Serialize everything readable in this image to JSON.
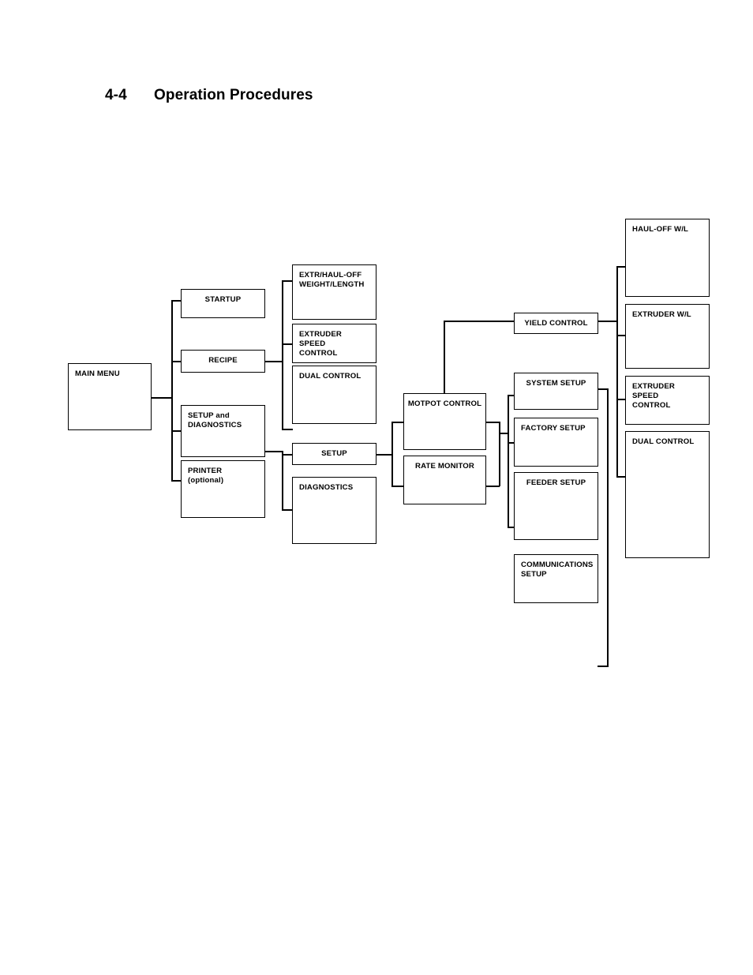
{
  "page": {
    "section_number": "4-4",
    "section_title": "Operation Procedures"
  },
  "diagram": {
    "type": "menu-tree",
    "root": "MAIN MENU",
    "nodes": {
      "main_menu": "MAIN MENU",
      "startup": "STARTUP",
      "recipe": "RECIPE",
      "setup_and_diagnostics": "SETUP and\nDIAGNOSTICS",
      "printer_optional": "PRINTER (optional)",
      "extr_haul_off_weight_length": "EXTR/HAUL-OFF\nWEIGHT/LENGTH",
      "extruder_speed_control_col2": "EXTRUDER SPEED\nCONTROL",
      "dual_control_col2": "DUAL CONTROL",
      "setup": "SETUP",
      "diagnostics": "DIAGNOSTICS",
      "motpot_control": "MOTPOT CONTROL",
      "rate_monitor": "RATE MONITOR",
      "yield_control": "YIELD CONTROL",
      "system_setup": "SYSTEM SETUP",
      "factory_setup": "FACTORY SETUP",
      "feeder_setup": "FEEDER SETUP",
      "communications_setup": "COMMUNICATIONS\nSETUP",
      "haul_off_wl": "HAUL-OFF W/L",
      "extruder_wl": "EXTRUDER W/L",
      "extruder_speed_control_col5": "EXTRUDER SPEED\nCONTROL",
      "dual_control_col5": "DUAL CONTROL"
    },
    "edges": [
      {
        "from": "main_menu",
        "to": "startup"
      },
      {
        "from": "main_menu",
        "to": "recipe"
      },
      {
        "from": "main_menu",
        "to": "setup_and_diagnostics"
      },
      {
        "from": "main_menu",
        "to": "printer_optional"
      },
      {
        "from": "recipe",
        "to": "extr_haul_off_weight_length"
      },
      {
        "from": "recipe",
        "to": "extruder_speed_control_col2"
      },
      {
        "from": "recipe",
        "to": "dual_control_col2"
      },
      {
        "from": "setup_and_diagnostics",
        "to": "setup"
      },
      {
        "from": "setup_and_diagnostics",
        "to": "diagnostics"
      },
      {
        "from": "setup",
        "to": "motpot_control"
      },
      {
        "from": "setup",
        "to": "rate_monitor"
      },
      {
        "from": "motpot_control",
        "to": "yield_control"
      },
      {
        "from": "motpot_control",
        "to": "system_setup"
      },
      {
        "from": "motpot_control",
        "to": "factory_setup"
      },
      {
        "from": "motpot_control",
        "to": "feeder_setup"
      },
      {
        "from": "rate_monitor",
        "to": "system_setup"
      },
      {
        "from": "yield_control",
        "to": "haul_off_wl"
      },
      {
        "from": "yield_control",
        "to": "extruder_wl"
      },
      {
        "from": "yield_control",
        "to": "extruder_speed_control_col5"
      },
      {
        "from": "yield_control",
        "to": "dual_control_col5"
      },
      {
        "from": "system_setup",
        "to": "haul_off_wl"
      },
      {
        "from": "communications_setup",
        "to": "dual_control_col5"
      }
    ],
    "colors": {
      "line": "#000000",
      "box_fill": "#ffffff",
      "text": "#000000"
    }
  }
}
